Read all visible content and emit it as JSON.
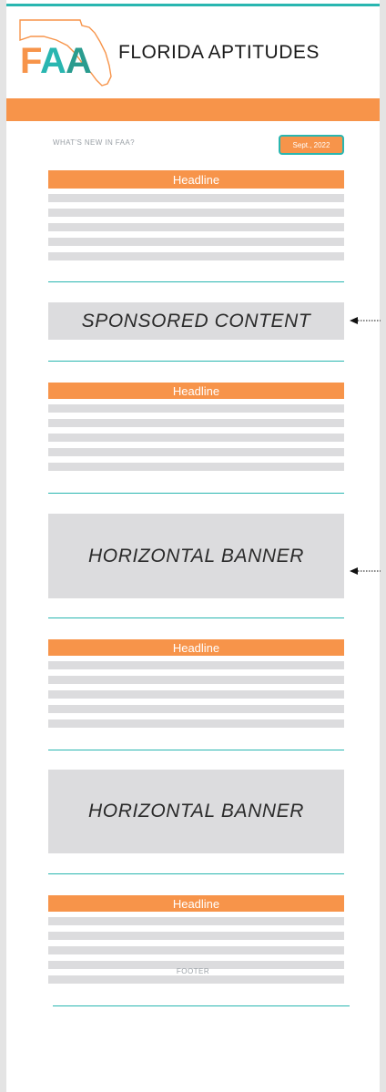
{
  "header": {
    "logo_text": "FAA",
    "site_title": "FLORIDA APTITUDES"
  },
  "intro": {
    "whats_new": "WHAT'S NEW IN FAA?",
    "date": "Sept., 2022"
  },
  "articles": [
    {
      "headline": "Headline"
    },
    {
      "headline": "Headline"
    },
    {
      "headline": "Headline"
    },
    {
      "headline": "Headline"
    }
  ],
  "ads": {
    "sponsored": "SPONSORED CONTENT",
    "banner_1": "HORIZONTAL BANNER",
    "banner_2": "HORIZONTAL BANNER"
  },
  "footer": {
    "label": "FOOTER"
  },
  "colors": {
    "orange": "#f7944a",
    "teal": "#29b6b0",
    "placeholder_gray": "#dcdcde"
  }
}
